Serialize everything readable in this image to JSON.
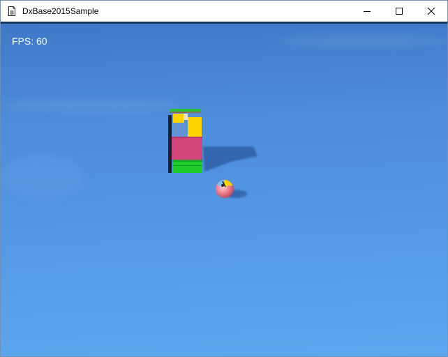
{
  "window": {
    "title": "DxBase2015Sample",
    "icon": "document-icon",
    "controls": {
      "minimize_icon": "minimize-icon",
      "maximize_icon": "maximize-icon",
      "close_icon": "close-icon"
    }
  },
  "overlay": {
    "fps_text": "FPS: 60"
  },
  "scene": {
    "background_color": "#4e8edc",
    "objects": [
      {
        "name": "block-tower",
        "colors": [
          "#1fcc2b",
          "#d1457b",
          "#ffd400",
          "#5a8fd0"
        ]
      },
      {
        "name": "ball",
        "colors": [
          "#ee7b8b",
          "#ffd400",
          "#5a8fd0"
        ]
      }
    ]
  }
}
